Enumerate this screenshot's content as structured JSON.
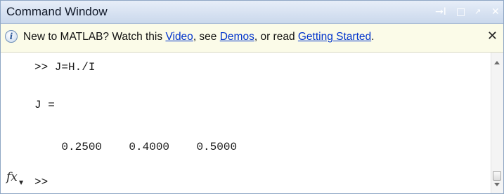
{
  "window": {
    "title": "Command Window",
    "controls": {
      "undock": "→I",
      "maximize": "□",
      "minimize": "↗",
      "close": "✕"
    }
  },
  "infobar": {
    "prefix": "New to MATLAB? Watch this ",
    "video_link": "Video",
    "sep1": ", see ",
    "demos_link": "Demos",
    "sep2": ", or read ",
    "getting_started_link": "Getting Started",
    "suffix": ".",
    "close_label": "✕",
    "icon": "info-icon"
  },
  "console": {
    "lines": [
      {
        "text": ">> J=H./I"
      },
      {
        "text": "J ="
      },
      {
        "text": "    0.2500    0.4000    0.5000"
      }
    ],
    "prompt": ">>",
    "fx_label": "fx"
  },
  "colors": {
    "title_bar": "#cad8ec",
    "info_bar": "#fbfbe8",
    "link": "#0033cc"
  }
}
